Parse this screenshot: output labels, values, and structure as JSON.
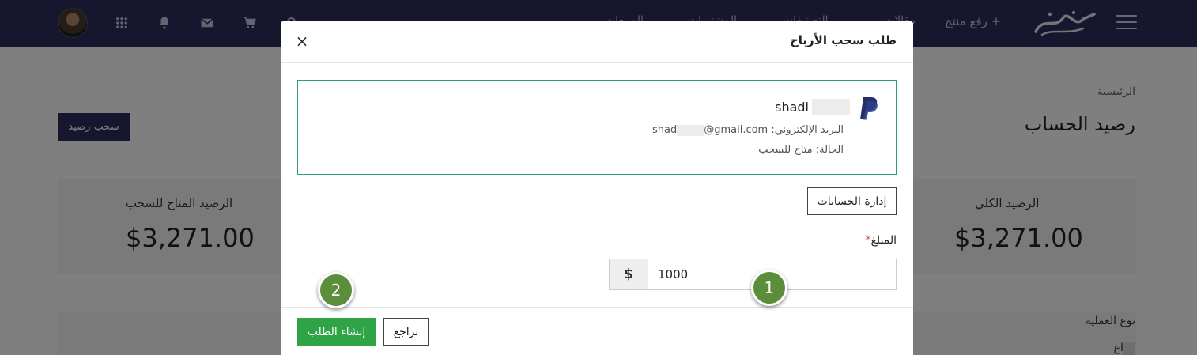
{
  "topbar": {
    "upload_label": "+ رفع منتج",
    "logo_text": "بيكاليما",
    "nav_items": [
      "مقالات",
      "التصنيفات",
      "المشتريات",
      "المبيعات"
    ],
    "icons": [
      "menu-icon",
      "search-icon",
      "cart-icon",
      "mail-icon",
      "bell-icon",
      "apps-grid-icon"
    ]
  },
  "page": {
    "breadcrumb": "الرئيسية",
    "title": "رصيد الحساب",
    "withdraw_button": "سحب رصيد",
    "total_balance_label": "الرصيد الكلي",
    "total_balance_value": "$3,271.00",
    "available_balance_label": "الرصيد المتاح للسحب",
    "available_balance_value": "$3,271.00",
    "operation_type_label": "نوع العملية",
    "operation_type_option": "ايداع"
  },
  "modal": {
    "title": "طلب سحب الأرباح",
    "close_symbol": "×",
    "account": {
      "provider_icon": "paypal-icon",
      "name": "shadi",
      "email_label": "البريد الإلكتروني:",
      "email_prefix": "shad",
      "email_domain": "@gmail.com",
      "status_label": "الحالة:",
      "status_value": "متاح للسحب"
    },
    "manage_accounts_button": "إدارة الحسابات",
    "amount_label": "المبلغ",
    "required_mark": "*",
    "currency_addon": "$",
    "amount_value": "1000",
    "submit_button": "إنشاء الطلب",
    "back_button": "تراجع"
  },
  "steps": {
    "step1": "1",
    "step2": "2"
  },
  "colors": {
    "topbar": "#2c2f5c",
    "account_border": "#2e9e6a",
    "submit_button": "#2ea447",
    "step_marker": "#5b8d3a"
  }
}
